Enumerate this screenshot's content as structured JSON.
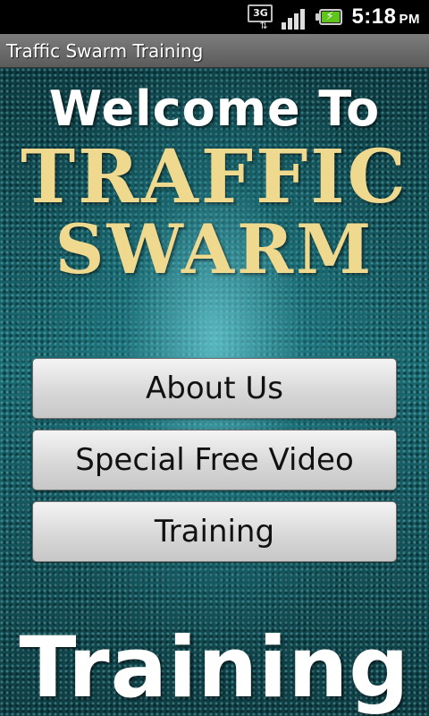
{
  "status_bar": {
    "network_label": "3G",
    "time": "5:18",
    "ampm": "PM",
    "battery_color": "#5fc51d",
    "icons": [
      "3g-network-icon",
      "signal-strength-icon",
      "battery-charging-icon"
    ]
  },
  "app": {
    "title": "Traffic Swarm Training"
  },
  "banner": {
    "line1": "Welcome To",
    "line2": "TRAFFIC",
    "line3": "SWARM",
    "accent_color": "#efd98e"
  },
  "menu": {
    "about_label": "About Us",
    "video_label": "Special Free Video",
    "training_label": "Training"
  },
  "footer": {
    "text": "Training"
  }
}
